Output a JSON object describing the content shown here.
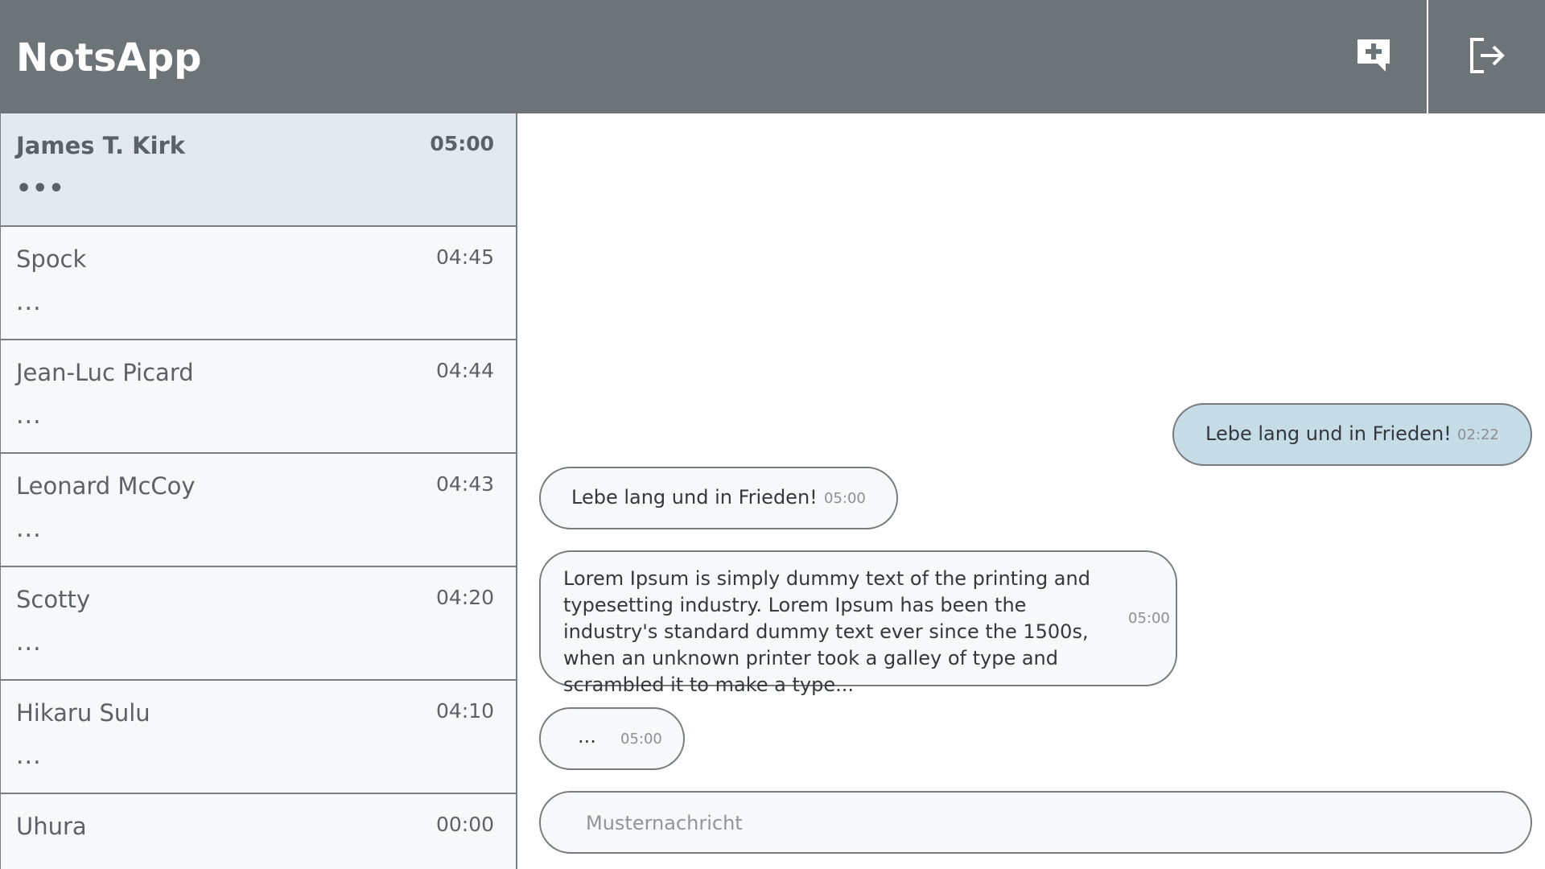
{
  "header": {
    "title": "NotsApp",
    "new_chat_icon": "message-plus-icon",
    "logout_icon": "logout-icon"
  },
  "chats": [
    {
      "name": "James T. Kirk",
      "time": "05:00",
      "preview": "•••",
      "active": true
    },
    {
      "name": "Spock",
      "time": "04:45",
      "preview": "..."
    },
    {
      "name": "Jean-Luc Picard",
      "time": "04:44",
      "preview": "..."
    },
    {
      "name": "Leonard McCoy",
      "time": "04:43",
      "preview": "..."
    },
    {
      "name": "Scotty",
      "time": "04:20",
      "preview": "..."
    },
    {
      "name": "Hikaru Sulu",
      "time": "04:10",
      "preview": "..."
    },
    {
      "name": "Uhura",
      "time": "00:00",
      "preview": ""
    }
  ],
  "messages": [
    {
      "text": "Lebe lang und in Frieden!",
      "time": "02:22",
      "own": true
    },
    {
      "text": "Lebe lang und in Frieden!",
      "time": "05:00",
      "own": false
    },
    {
      "text": "Lorem Ipsum is simply dummy text of the printing and typesetting industry. Lorem Ipsum has been the industry's standard dummy text ever since the 1500s, when an unknown printer took a galley of type and scrambled it to make a type...",
      "time": "05:00",
      "own": false
    },
    {
      "text": "...",
      "time": "05:00",
      "own": false
    }
  ],
  "composer": {
    "placeholder": "Musternachricht",
    "value": ""
  },
  "colors": {
    "header_bg": "#6c7478",
    "active_chat_bg": "#e4e9f0",
    "own_bubble_bg": "#c6dce6"
  }
}
